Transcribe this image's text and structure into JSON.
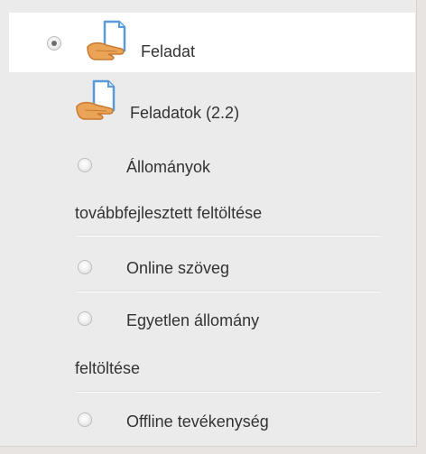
{
  "module": {
    "label": "Feladat"
  },
  "assignment_group": {
    "label": "Feladatok (2.2)"
  },
  "subtypes": [
    {
      "line1": "Állományok",
      "line2": "továbbfejlesztett feltöltése"
    },
    {
      "line1": "Online szöveg"
    },
    {
      "line1": "Egyetlen állomány",
      "line2": "feltöltése"
    },
    {
      "line1": "Offline tevékenység"
    }
  ],
  "colors": {
    "icon_doc": "#5a9ad6",
    "icon_hand": "#e8a253"
  },
  "icons": {
    "module": "assignment-hand-document-icon",
    "group": "assignment-hand-document-icon"
  }
}
